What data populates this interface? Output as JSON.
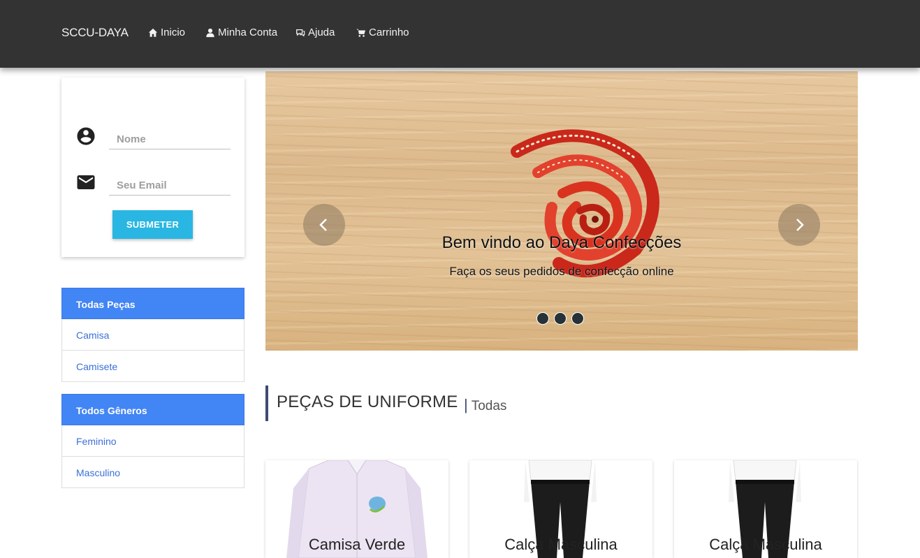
{
  "navbar": {
    "brand": "SCCU-DAYA",
    "items": [
      {
        "label": "Inicio",
        "icon": "home-icon"
      },
      {
        "label": "Minha Conta",
        "icon": "user-icon"
      },
      {
        "label": "Ajuda",
        "icon": "chat-icon"
      },
      {
        "label": "Carrinho",
        "icon": "cart-icon"
      }
    ]
  },
  "login": {
    "name_placeholder": "Nome",
    "email_placeholder": "Seu Email",
    "submit_label": "SUBMETER"
  },
  "sidebar": {
    "pieces": {
      "header": "Todas Peças",
      "items": [
        "Camisa",
        "Camisete"
      ]
    },
    "genders": {
      "header": "Todos Gêneros",
      "items": [
        "Feminino",
        "Masculino"
      ]
    }
  },
  "carousel": {
    "title": "Bem vindo ao Daya Confecções",
    "subtitle": "Faça os seus pedidos de confecção online",
    "slide_count": 3
  },
  "section": {
    "title": "PEÇAS DE UNIFORME",
    "filter": "Todas"
  },
  "products": [
    {
      "title": "Camisa Verde",
      "image": "white-shirt-image"
    },
    {
      "title": "Calça Masculina",
      "image": "black-trousers-image"
    },
    {
      "title": "Calça Masculina",
      "image": "black-trousers-image"
    }
  ],
  "colors": {
    "navbar": "#333333",
    "accent_blue": "#4285f4",
    "submit_button": "#29b6e2",
    "section_bar": "#3d4a73"
  }
}
